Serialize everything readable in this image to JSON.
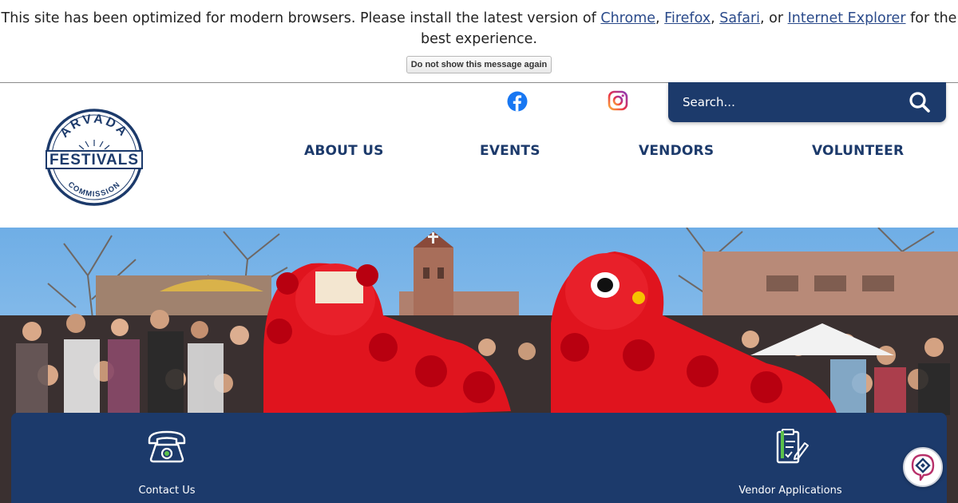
{
  "notice": {
    "text_before": "This site has been optimized for modern browsers. Please install the latest version of ",
    "links": [
      "Chrome",
      "Firefox",
      "Safari",
      "Internet Explorer"
    ],
    "sep_1": ", ",
    "sep_2": ", ",
    "sep_3": ", or ",
    "text_after": " for the best experience.",
    "dismiss_label": "Do not show this message again"
  },
  "header": {
    "logo_text": {
      "top": "ARVADA",
      "middle": "FESTIVALS",
      "bottom": "COMMISSION"
    },
    "social": [
      "facebook-icon",
      "instagram-icon"
    ],
    "search_placeholder": "Search..."
  },
  "nav": {
    "items": [
      "ABOUT US",
      "EVENTS",
      "VENDORS",
      "VOLUNTEER"
    ]
  },
  "quick_links": {
    "items": [
      {
        "label": "Contact Us",
        "icon": "telephone-icon"
      },
      {
        "label": "Vendor Applications",
        "icon": "clipboard-icon"
      }
    ]
  },
  "colors": {
    "brand_navy": "#1c3a6b",
    "lion_red": "#e0141e",
    "sky": "#8fc2ec",
    "link_blue": "#2a4a8a"
  }
}
